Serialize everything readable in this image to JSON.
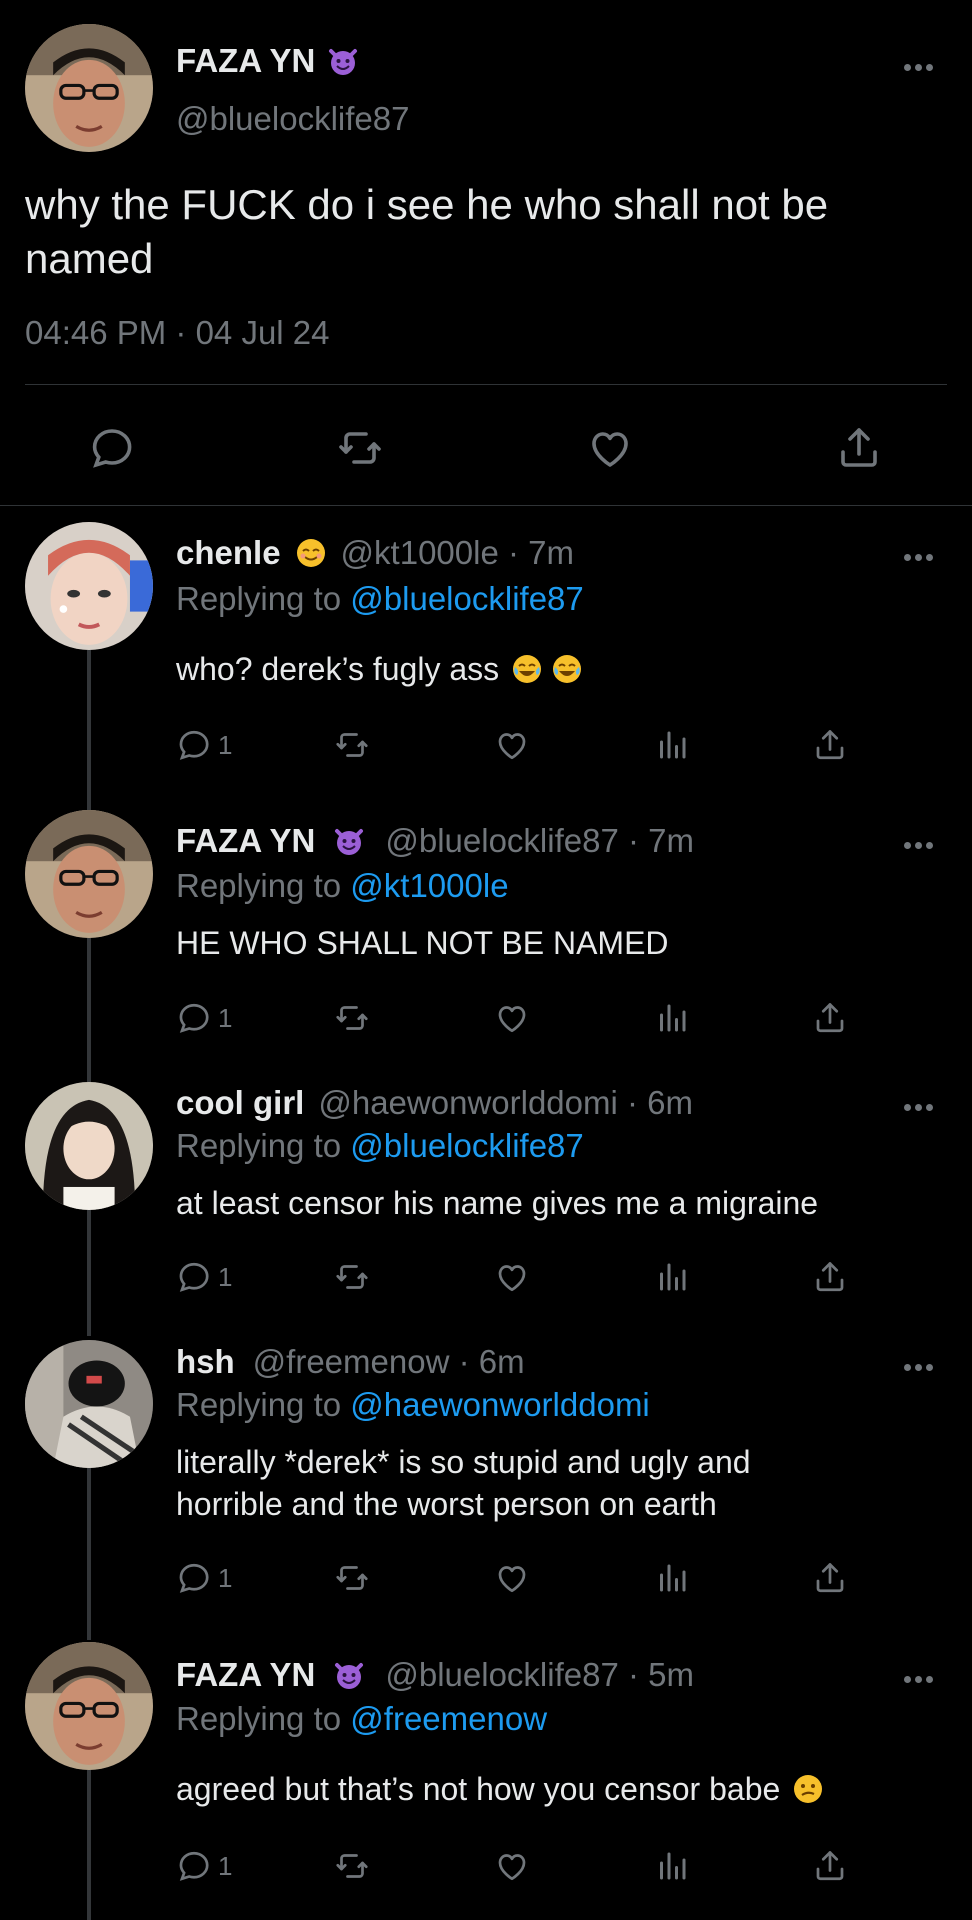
{
  "main_tweet": {
    "name": "FAZA YN",
    "handle": "@bluelocklife87",
    "text_line1": "why the FUCK do i see he who shall not be",
    "text_line2": "named",
    "timestamp": "04:46 PM · 04 Jul 24",
    "badge_icon": "smiling-devil-emoji"
  },
  "replies": [
    {
      "name": "chenle",
      "emoji": "relieved-face-emoji",
      "handle_time": "@kt1000le · 7m",
      "replying_prefix": "Replying to",
      "replying_to": "@bluelocklife87",
      "text": "who? derek’s fugly ass",
      "trailing_emoji": "tears-of-joy-emoji",
      "reply_count": "1"
    },
    {
      "name": "FAZA YN",
      "emoji": "smiling-devil-emoji",
      "handle_time": "@bluelocklife87 · 7m",
      "replying_prefix": "Replying to",
      "replying_to": "@kt1000le",
      "text": "HE WHO SHALL NOT BE NAMED",
      "reply_count": "1"
    },
    {
      "name": "cool girl",
      "handle_time": "@haewonworlddomi · 6m",
      "replying_prefix": "Replying to",
      "replying_to": "@bluelocklife87",
      "text": "at least censor his name gives me a migraine",
      "reply_count": "1"
    },
    {
      "name": "hsh",
      "handle_time": "@freemenow · 6m",
      "replying_prefix": "Replying to",
      "replying_to": "@haewonworlddomi",
      "text_line1": "literally *derek* is so stupid and ugly and",
      "text_line2": "horrible and the worst person on earth",
      "reply_count": "1"
    },
    {
      "name": "FAZA YN",
      "emoji": "smiling-devil-emoji",
      "handle_time": "@bluelocklife87 · 5m",
      "replying_prefix": "Replying to",
      "replying_to": "@freemenow",
      "text": "agreed but that’s not how you censor babe",
      "trailing_emoji": "confused-face-emoji",
      "reply_count": "1"
    }
  ],
  "colors": {
    "background": "#000000",
    "text": "#e7e9ea",
    "muted": "#71767b",
    "link": "#1d9bf0",
    "divider": "#2f3336"
  }
}
